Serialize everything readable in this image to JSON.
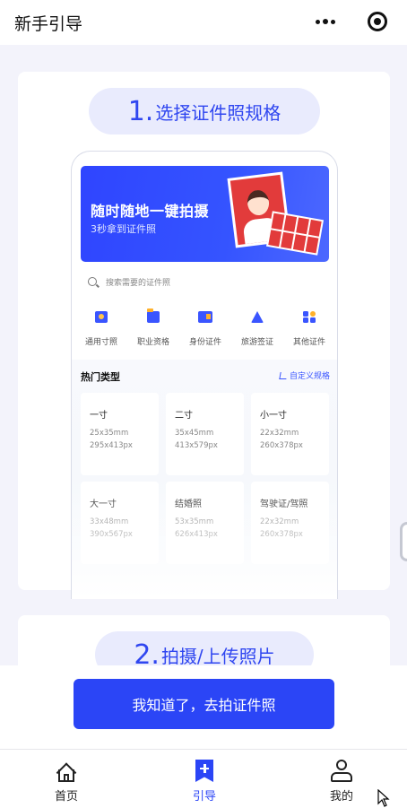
{
  "nav": {
    "title": "新手引导",
    "more_icon": "more-dots-icon",
    "close_icon": "capsule-close-icon"
  },
  "step1": {
    "number": "1.",
    "title": "选择证件照规格",
    "preview": {
      "banner": {
        "title": "随时随地一键拍摄",
        "subtitle": "3秒拿到证件照"
      },
      "search_placeholder": "搜索需要的证件照",
      "categories": [
        {
          "label": "通用寸照",
          "icon": "portrait-icon"
        },
        {
          "label": "职业资格",
          "icon": "folder-icon"
        },
        {
          "label": "身份证件",
          "icon": "id-card-icon"
        },
        {
          "label": "旅游签证",
          "icon": "triangle-ruler-icon"
        },
        {
          "label": "其他证件",
          "icon": "grid-icon"
        }
      ],
      "hot": {
        "title": "热门类型",
        "custom_label": "自定义规格",
        "specs": [
          {
            "name": "一寸",
            "mm": "25x35mm",
            "px": "295x413px"
          },
          {
            "name": "二寸",
            "mm": "35x45mm",
            "px": "413x579px"
          },
          {
            "name": "小一寸",
            "mm": "22x32mm",
            "px": "260x378px"
          },
          {
            "name": "大一寸",
            "mm": "33x48mm",
            "px": "390x567px"
          },
          {
            "name": "结婚照",
            "mm": "53x35mm",
            "px": "626x413px"
          },
          {
            "name": "驾驶证/驾照",
            "mm": "22x32mm",
            "px": "260x378px"
          }
        ]
      }
    }
  },
  "step2": {
    "number": "2.",
    "title": "拍摄/上传照片"
  },
  "cta_label": "我知道了，去拍证件照",
  "tabs": [
    {
      "label": "首页",
      "icon": "home-icon"
    },
    {
      "label": "引导",
      "icon": "guide-bookmark-icon"
    },
    {
      "label": "我的",
      "icon": "user-icon"
    }
  ],
  "colors": {
    "accent": "#2b45f6",
    "pill_bg": "#e9ebfd",
    "page_bg": "#f3f3fb",
    "photo_red": "#e23b3b"
  }
}
